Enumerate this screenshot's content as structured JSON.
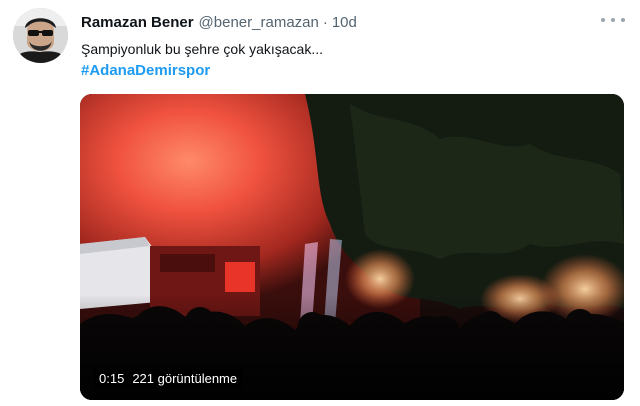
{
  "tweet": {
    "author_name": "Ramazan Bener",
    "author_handle": "@bener_ramazan",
    "separator": "·",
    "timestamp": "10d",
    "text": "Şampiyonluk bu şehre çok yakışacak...",
    "hashtag": "#AdanaDemirspor",
    "more_icon": "more-horizontal-icon",
    "video": {
      "duration": "0:15",
      "views": "221 görüntülenme"
    }
  },
  "colors": {
    "text_primary": "#0f1419",
    "text_secondary": "#536471",
    "link": "#1d9bf0"
  }
}
